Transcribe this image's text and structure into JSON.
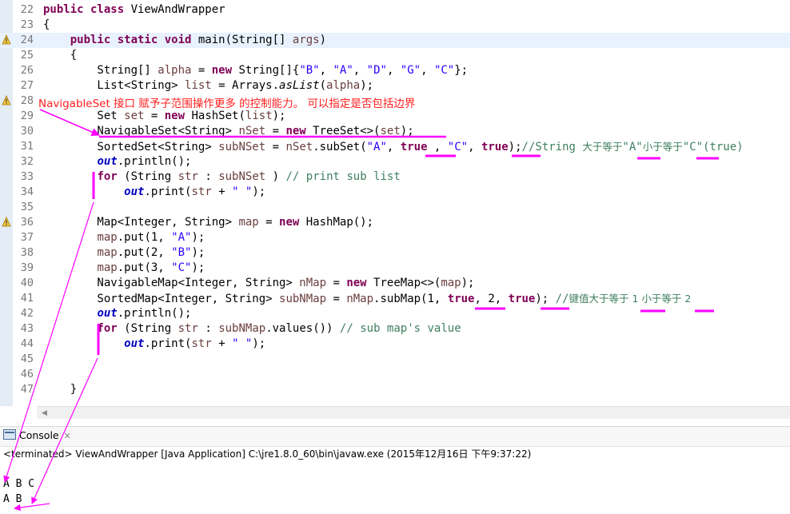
{
  "editor": {
    "lines": [
      {
        "num": "22",
        "parts": [
          [
            "kw",
            "public class "
          ],
          [
            "",
            "ViewAndWrapper"
          ]
        ]
      },
      {
        "num": "23",
        "parts": [
          [
            "",
            "{"
          ]
        ]
      },
      {
        "num": "24",
        "current": true,
        "parts": [
          [
            "",
            "    "
          ],
          [
            "kw",
            "public static void "
          ],
          [
            "",
            "main(String[] "
          ],
          [
            "var",
            "args"
          ],
          [
            "",
            ")"
          ]
        ]
      },
      {
        "num": "25",
        "parts": [
          [
            "",
            "    {"
          ]
        ]
      },
      {
        "num": "26",
        "parts": [
          [
            "",
            "        String[] "
          ],
          [
            "var",
            "alpha"
          ],
          [
            "",
            " = "
          ],
          [
            "kw",
            "new "
          ],
          [
            "",
            "String[]{"
          ],
          [
            "str",
            "\"B\""
          ],
          [
            "",
            ", "
          ],
          [
            "str",
            "\"A\""
          ],
          [
            "",
            ", "
          ],
          [
            "str",
            "\"D\""
          ],
          [
            "",
            ", "
          ],
          [
            "str",
            "\"G\""
          ],
          [
            "",
            ", "
          ],
          [
            "str",
            "\"C\""
          ],
          [
            "",
            "};"
          ]
        ]
      },
      {
        "num": "27",
        "parts": [
          [
            "",
            "        List<String> "
          ],
          [
            "var",
            "list"
          ],
          [
            "",
            " = Arrays."
          ],
          [
            "sm",
            "asList"
          ],
          [
            "",
            "("
          ],
          [
            "var",
            "alpha"
          ],
          [
            "",
            ");"
          ]
        ]
      },
      {
        "num": "28",
        "parts": []
      },
      {
        "num": "29",
        "parts": [
          [
            "",
            "        Set "
          ],
          [
            "var",
            "set"
          ],
          [
            "",
            " = "
          ],
          [
            "kw",
            "new "
          ],
          [
            "",
            "HashSet("
          ],
          [
            "var",
            "list"
          ],
          [
            "",
            ");"
          ]
        ]
      },
      {
        "num": "30",
        "parts": [
          [
            "",
            "        NavigableSet<String> "
          ],
          [
            "var",
            "nSet"
          ],
          [
            "",
            " = "
          ],
          [
            "kw",
            "new "
          ],
          [
            "",
            "TreeSet<>("
          ],
          [
            "var",
            "set"
          ],
          [
            "",
            ");"
          ]
        ]
      },
      {
        "num": "31",
        "parts": [
          [
            "",
            "        SortedSet<String> "
          ],
          [
            "var",
            "subNSet"
          ],
          [
            "",
            " = "
          ],
          [
            "var",
            "nSet"
          ],
          [
            "",
            ".subSet("
          ],
          [
            "str",
            "\"A\""
          ],
          [
            "",
            ", "
          ],
          [
            "kw",
            "true"
          ],
          [
            "",
            " , "
          ],
          [
            "str",
            "\"C\""
          ],
          [
            "",
            ", "
          ],
          [
            "kw",
            "true"
          ],
          [
            "",
            ");"
          ],
          [
            "cmt",
            "//String "
          ],
          [
            "cmtcjk",
            "大于等于"
          ],
          [
            "cmt",
            "\"A\""
          ],
          [
            "cmtcjk",
            "小于等于"
          ],
          [
            "cmt",
            "\"C\"(true)"
          ]
        ]
      },
      {
        "num": "32",
        "parts": [
          [
            "",
            "        "
          ],
          [
            "fld",
            "out"
          ],
          [
            "",
            ".println();"
          ]
        ]
      },
      {
        "num": "33",
        "parts": [
          [
            "",
            "        "
          ],
          [
            "kw",
            "for "
          ],
          [
            "",
            "(String "
          ],
          [
            "var",
            "str"
          ],
          [
            "",
            " : "
          ],
          [
            "var",
            "subNSet"
          ],
          [
            "",
            " ) "
          ],
          [
            "cmt",
            "// print sub list"
          ]
        ]
      },
      {
        "num": "34",
        "parts": [
          [
            "",
            "            "
          ],
          [
            "fld",
            "out"
          ],
          [
            "",
            ".print("
          ],
          [
            "var",
            "str"
          ],
          [
            "",
            " + "
          ],
          [
            "str",
            "\" \""
          ],
          [
            "",
            ");"
          ]
        ]
      },
      {
        "num": "35",
        "parts": []
      },
      {
        "num": "36",
        "parts": [
          [
            "",
            "        Map<Integer, String> "
          ],
          [
            "var",
            "map"
          ],
          [
            "",
            " = "
          ],
          [
            "kw",
            "new "
          ],
          [
            "",
            "HashMap();"
          ]
        ]
      },
      {
        "num": "37",
        "parts": [
          [
            "",
            "        "
          ],
          [
            "var",
            "map"
          ],
          [
            "",
            ".put(1, "
          ],
          [
            "str",
            "\"A\""
          ],
          [
            "",
            ");"
          ]
        ]
      },
      {
        "num": "38",
        "parts": [
          [
            "",
            "        "
          ],
          [
            "var",
            "map"
          ],
          [
            "",
            ".put(2, "
          ],
          [
            "str",
            "\"B\""
          ],
          [
            "",
            ");"
          ]
        ]
      },
      {
        "num": "39",
        "parts": [
          [
            "",
            "        "
          ],
          [
            "var",
            "map"
          ],
          [
            "",
            ".put(3, "
          ],
          [
            "str",
            "\"C\""
          ],
          [
            "",
            ");"
          ]
        ]
      },
      {
        "num": "40",
        "parts": [
          [
            "",
            "        NavigableMap<Integer, String> "
          ],
          [
            "var",
            "nMap"
          ],
          [
            "",
            " = "
          ],
          [
            "kw",
            "new "
          ],
          [
            "",
            "TreeMap<>("
          ],
          [
            "var",
            "map"
          ],
          [
            "",
            ");"
          ]
        ]
      },
      {
        "num": "41",
        "parts": [
          [
            "",
            "        SortedMap<Integer, String> "
          ],
          [
            "var",
            "subNMap"
          ],
          [
            "",
            " = "
          ],
          [
            "var",
            "nMap"
          ],
          [
            "",
            ".subMap(1, "
          ],
          [
            "kw",
            "true"
          ],
          [
            "",
            ", 2, "
          ],
          [
            "kw",
            "true"
          ],
          [
            "",
            "); "
          ],
          [
            "cmt",
            "//"
          ],
          [
            "cmtcjk",
            "键值大于等于 1 小于等于 2"
          ]
        ]
      },
      {
        "num": "42",
        "parts": [
          [
            "",
            "        "
          ],
          [
            "fld",
            "out"
          ],
          [
            "",
            ".println();"
          ]
        ]
      },
      {
        "num": "43",
        "parts": [
          [
            "",
            "        "
          ],
          [
            "kw",
            "for "
          ],
          [
            "",
            "(String "
          ],
          [
            "var",
            "str"
          ],
          [
            "",
            " : "
          ],
          [
            "var",
            "subNMap"
          ],
          [
            "",
            ".values()) "
          ],
          [
            "cmt",
            "// sub map's value"
          ]
        ]
      },
      {
        "num": "44",
        "parts": [
          [
            "",
            "            "
          ],
          [
            "fld",
            "out"
          ],
          [
            "",
            ".print("
          ],
          [
            "var",
            "str"
          ],
          [
            "",
            " + "
          ],
          [
            "str",
            "\" \""
          ],
          [
            "",
            ");"
          ]
        ]
      },
      {
        "num": "45",
        "parts": []
      },
      {
        "num": "46",
        "parts": []
      },
      {
        "num": "47",
        "parts": [
          [
            "",
            "    }"
          ]
        ]
      }
    ]
  },
  "annotation": {
    "text": "NavigableSet 接口 赋予子范围操作更多 的控制能力。 可以指定是否包括边界",
    "color": "#ff2020",
    "arrow_color": "#ff00ff"
  },
  "console": {
    "tab_label": "Console",
    "close_glyph": "✕",
    "status": "<terminated> ViewAndWrapper [Java Application] C:\\jre1.8.0_60\\bin\\javaw.exe (2015年12月16日 下午9:37:22)",
    "output": [
      "A B C",
      "A B"
    ]
  },
  "icons": {
    "console": "console-icon",
    "warning": "warning-icon",
    "scroll_left": "scroll-left-arrow-icon"
  }
}
